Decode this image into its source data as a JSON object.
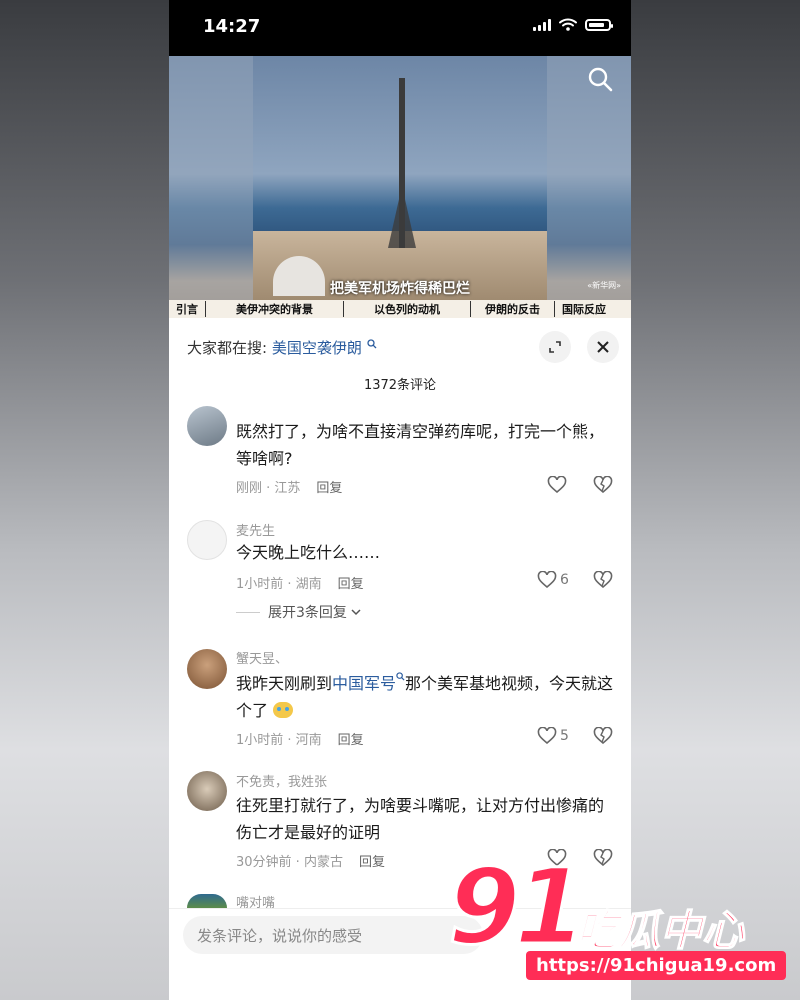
{
  "status_bar": {
    "time": "14:27"
  },
  "video": {
    "caption": "把美军机场炸得稀巴烂",
    "watermark": "«新华网»",
    "chapters": [
      "引言",
      "美伊冲突的背景",
      "以色列的动机",
      "伊朗的反击",
      "国际反应"
    ]
  },
  "panel": {
    "search_prefix": "大家都在搜:",
    "search_term": "美国空袭伊朗",
    "comment_count": "1372条评论"
  },
  "comments": [
    {
      "username": "",
      "text": "既然打了，为啥不直接清空弹药库呢，打完一个熊，等啥啊?",
      "meta": "刚刚 · 江苏",
      "reply": "回复",
      "likes": ""
    },
    {
      "username": "麦先生",
      "text": "今天晚上吃什么……",
      "meta": "1小时前 · 湖南",
      "reply": "回复",
      "likes": "6",
      "expand": "展开3条回复"
    },
    {
      "username": "蟹天昱、",
      "text_before": "我昨天刚刷到",
      "text_link": "中国军号",
      "text_after": "那个美军基地视频，今天就这个了",
      "meta": "1小时前 · 河南",
      "reply": "回复",
      "likes": "5"
    },
    {
      "username": "不免责，我姓张",
      "text": "往死里打就行了，为啥要斗嘴呢，让对方付出惨痛的伤亡才是最好的证明",
      "meta": "30分钟前 · 内蒙古",
      "reply": "回复",
      "likes": ""
    },
    {
      "username": "嘴对嘴",
      "text": ""
    }
  ],
  "input": {
    "placeholder": "发条评论，说说你的感受"
  },
  "watermark_brand": {
    "digits": "91",
    "name": "吃瓜中心",
    "url": "https://91chigua19.com"
  },
  "colors": {
    "link": "#2b5c9e",
    "brand": "#ff2d56"
  }
}
